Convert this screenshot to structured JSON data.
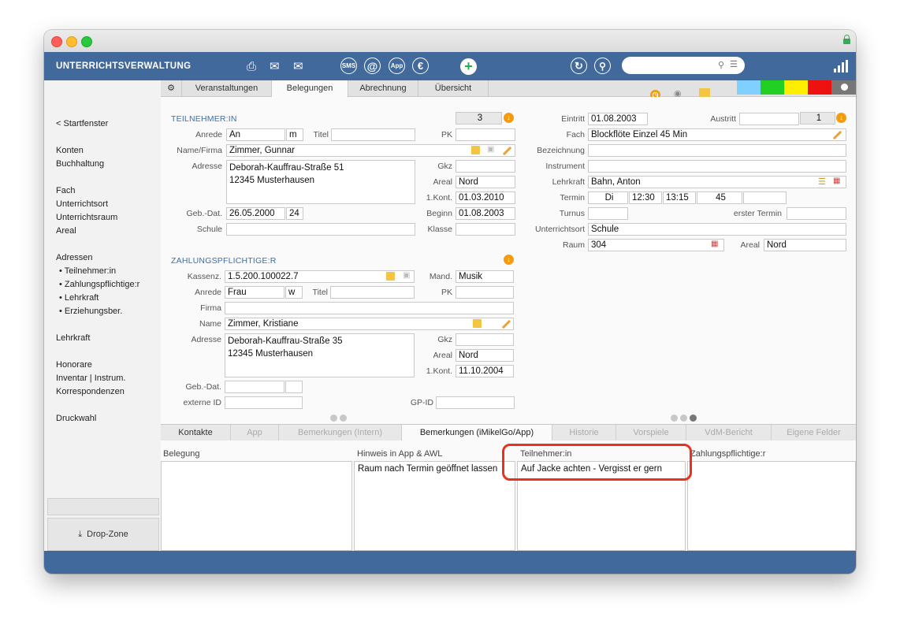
{
  "app": {
    "title": "UNTERRICHTSVERWALTUNG"
  },
  "toolbar": {
    "search_placeholder": "",
    "sms_label": "SMS",
    "app_label": "App"
  },
  "sidebar": {
    "back": "< Startfenster",
    "items": [
      "Konten",
      "Buchhaltung",
      "Fach",
      "Unterrichtsort",
      "Unterrichtsraum",
      "Areal",
      "Adressen"
    ],
    "sub_items": [
      "• Teilnehmer:in",
      "• Zahlungspflichtige:r",
      "• Lehrkraft",
      "• Erziehungsber."
    ],
    "items2": [
      "Lehrkraft",
      "Honorare",
      "Inventar | Instrum.",
      "Korrespondenzen",
      "Druckwahl"
    ],
    "drop_zone": "Drop-Zone"
  },
  "tabs": [
    "Veranstaltungen",
    "Belegungen",
    "Abrechnung",
    "Übersicht"
  ],
  "colors": {
    "toolbar": "#41699c",
    "accent_label": "#3e6ea8",
    "highlight": "#e8321e",
    "swatches": [
      "#7fd0ff",
      "#22d022",
      "#ffee00",
      "#ee1111",
      "#777777"
    ]
  },
  "teilnehmer": {
    "title": "TEILNEHMER:IN",
    "count": "3",
    "anrede_label": "Anrede",
    "anrede": "An",
    "gender": "m",
    "titel_label": "Titel",
    "titel": "",
    "pk_label": "PK",
    "pk": "",
    "name_label": "Name/Firma",
    "name": "Zimmer, Gunnar",
    "adresse_label": "Adresse",
    "adresse_line1": "Deborah-Kauffrau-Straße 51",
    "adresse_line2": "12345 Musterhausen",
    "gkz_label": "Gkz",
    "gkz": "",
    "areal_label": "Areal",
    "areal": "Nord",
    "kont_label": "1.Kont.",
    "kont": "01.03.2010",
    "geb_label": "Geb.-Dat.",
    "geb": "26.05.2000",
    "alter": "24",
    "beginn_label": "Beginn",
    "beginn": "01.08.2003",
    "schule_label": "Schule",
    "schule": "",
    "klasse_label": "Klasse",
    "klasse": ""
  },
  "zahlungspflichtige": {
    "title": "ZAHLUNGSPFLICHTIGE:R",
    "kassenz_label": "Kassenz.",
    "kassenz": "1.5.200.100022.7",
    "mand_label": "Mand.",
    "mand": "Musik",
    "anrede_label": "Anrede",
    "anrede": "Frau",
    "gender": "w",
    "titel_label": "Titel",
    "titel": "",
    "pk_label": "PK",
    "pk": "",
    "firma_label": "Firma",
    "firma": "",
    "name_label": "Name",
    "name": "Zimmer, Kristiane",
    "adresse_label": "Adresse",
    "adresse_line1": "Deborah-Kauffrau-Straße 35",
    "adresse_line2": "12345 Musterhausen",
    "gkz_label": "Gkz",
    "gkz": "",
    "areal_label": "Areal",
    "areal": "Nord",
    "kont_label": "1.Kont.",
    "kont": "11.10.2004",
    "geb_label": "Geb.-Dat.",
    "geb": "",
    "externe_label": "externe ID",
    "externe": "",
    "gpid_label": "GP-ID",
    "gpid": ""
  },
  "belegung": {
    "eintritt_label": "Eintritt",
    "eintritt": "01.08.2003",
    "austritt_label": "Austritt",
    "austritt": "",
    "austritt_count": "1",
    "fach_label": "Fach",
    "fach": "Blockflöte Einzel 45 Min",
    "bezeichnung_label": "Bezeichnung",
    "bezeichnung": "",
    "instrument_label": "Instrument",
    "instrument": "",
    "lehrkraft_label": "Lehrkraft",
    "lehrkraft": "Bahn, Anton",
    "termin_label": "Termin",
    "termin_tag": "Di",
    "termin_von": "12:30",
    "termin_bis": "13:15",
    "termin_dauer": "45",
    "turnus_label": "Turnus",
    "turnus": "",
    "erster_label": "erster Termin",
    "erster": "",
    "ort_label": "Unterrichtsort",
    "ort": "Schule",
    "raum_label": "Raum",
    "raum": "304",
    "areal_label": "Areal",
    "areal": "Nord"
  },
  "bottom_tabs": [
    "Kontakte",
    "App",
    "Bemerkungen (Intern)",
    "Bemerkungen (iMikelGo/App)",
    "Historie",
    "Vorspiele",
    "VdM-Bericht",
    "Eigene Felder"
  ],
  "notes": {
    "cols": [
      "Belegung",
      "Hinweis in App & AWL",
      "Teilnehmer:in",
      "Zahlungspflichtige:r"
    ],
    "values": [
      "",
      "Raum nach Termin geöffnet lassen",
      "Auf Jacke achten - Vergisst er gern",
      ""
    ]
  }
}
